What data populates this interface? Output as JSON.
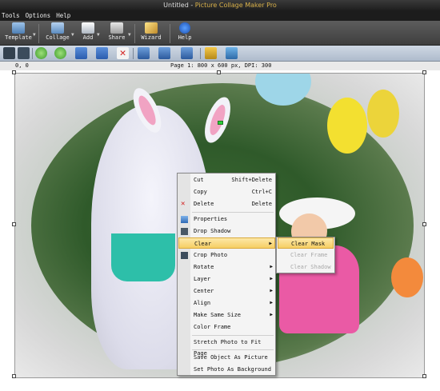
{
  "window": {
    "doc": "Untitled",
    "sep": " - ",
    "app": "Picture Collage Maker Pro"
  },
  "menu": [
    "Tools",
    "Options",
    "Help"
  ],
  "toolbar": {
    "template": "Template",
    "collage": "Collage",
    "add": "Add",
    "share": "Share",
    "wizard": "Wizard",
    "help": "Help"
  },
  "status": {
    "coords": "0, 0",
    "page_info": "Page 1: 800 x 600 px, DPI: 300"
  },
  "context_menu": {
    "cut": "Cut",
    "cut_shortcut": "Shift+Delete",
    "copy": "Copy",
    "copy_shortcut": "Ctrl+C",
    "delete": "Delete",
    "delete_shortcut": "Delete",
    "properties": "Properties",
    "drop_shadow": "Drop Shadow",
    "clear": "Clear",
    "crop_photo": "Crop Photo",
    "rotate": "Rotate",
    "layer": "Layer",
    "center": "Center",
    "align": "Align",
    "make_same_size": "Make Same Size",
    "color_frame": "Color Frame",
    "stretch_photo": "Stretch Photo to Fit Page",
    "save_object": "Save Object As Picture",
    "set_background": "Set Photo As Background"
  },
  "clear_submenu": {
    "clear_mask": "Clear Mask",
    "clear_frame": "Clear Frame",
    "clear_shadow": "Clear Shadow"
  },
  "colors": {
    "accent": "#f6cf64",
    "titlebar": "#1e1e1e",
    "app_title": "#d8b04a"
  }
}
